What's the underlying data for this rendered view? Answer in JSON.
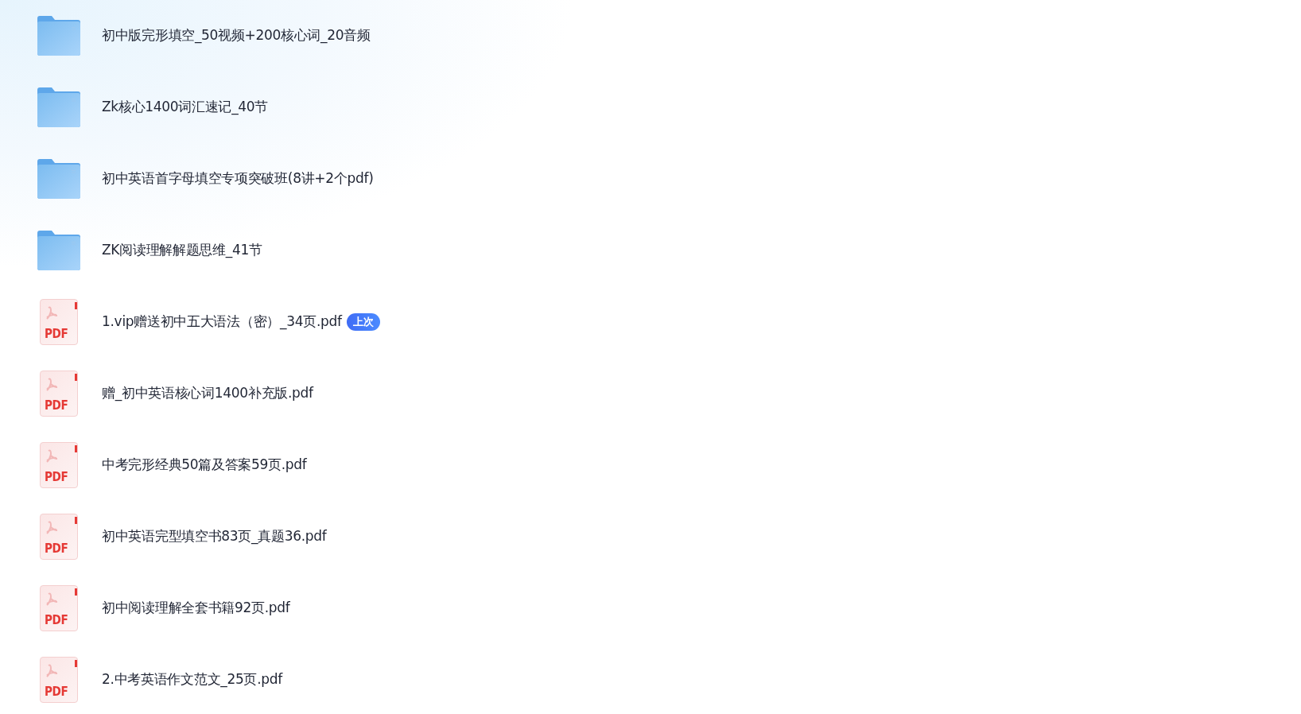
{
  "files": [
    {
      "kind": "folder",
      "name": "初中版完形填空_50视频+200核心词_20音频"
    },
    {
      "kind": "folder",
      "name": "Zk核心1400词汇速记_40节"
    },
    {
      "kind": "folder",
      "name": "初中英语首字母填空专项突破班(8讲+2个pdf)"
    },
    {
      "kind": "folder",
      "name": "ZK阅读理解解题思维_41节"
    },
    {
      "kind": "pdf",
      "icon_label": "PDF",
      "name": "1.vip赠送初中五大语法（密）_34页.pdf",
      "badge": "上次"
    },
    {
      "kind": "pdf",
      "icon_label": "PDF",
      "name": "赠_初中英语核心词1400补充版.pdf"
    },
    {
      "kind": "pdf",
      "icon_label": "PDF",
      "name": "中考完形经典50篇及答案59页.pdf"
    },
    {
      "kind": "pdf",
      "icon_label": "PDF",
      "name": "初中英语完型填空书83页_真题36.pdf"
    },
    {
      "kind": "pdf",
      "icon_label": "PDF",
      "name": "初中阅读理解全套书籍92页.pdf"
    },
    {
      "kind": "pdf",
      "icon_label": "PDF",
      "name": "2.中考英语作文范文_25页.pdf"
    }
  ]
}
